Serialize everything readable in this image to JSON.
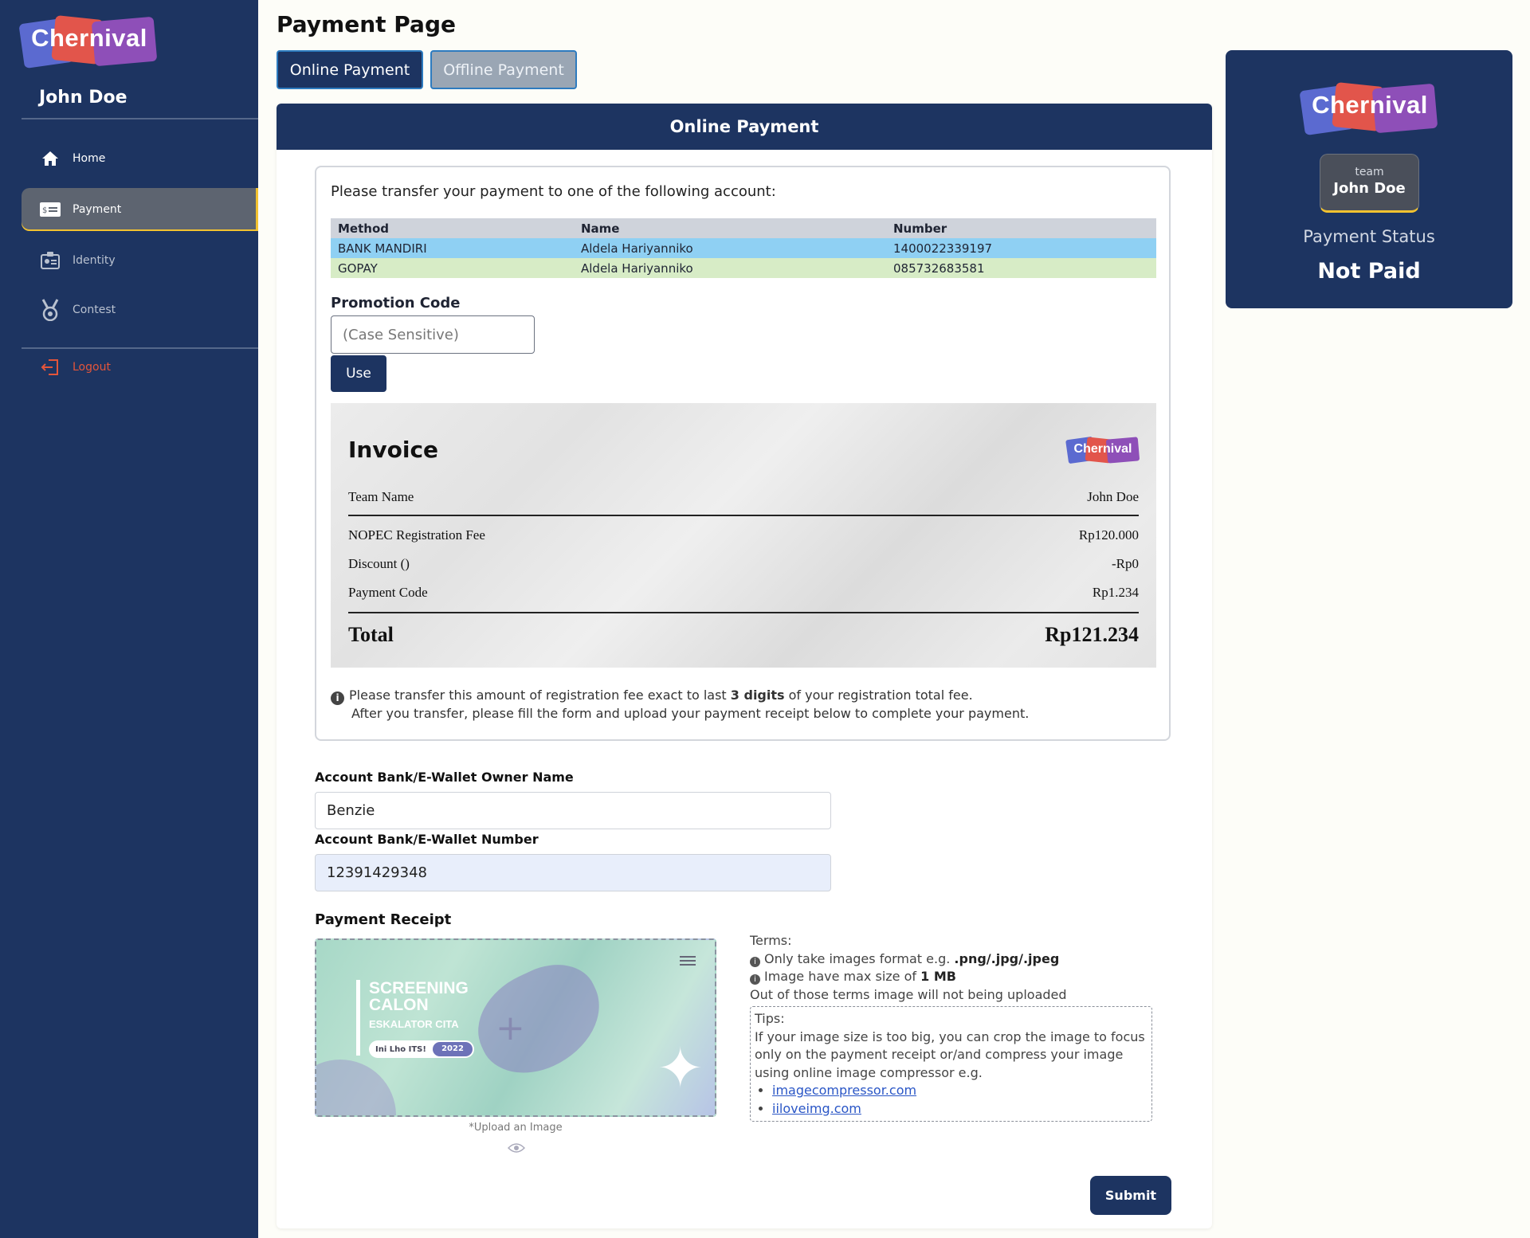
{
  "brand": {
    "name": "Chernival"
  },
  "sidebar": {
    "user_name": "John Doe",
    "items": [
      {
        "label": "Home",
        "icon": "home-icon"
      },
      {
        "label": "Payment",
        "icon": "payment-card-icon",
        "active": true
      },
      {
        "label": "Identity",
        "icon": "id-card-icon"
      },
      {
        "label": "Contest",
        "icon": "medal-icon"
      }
    ],
    "logout": "Logout"
  },
  "page": {
    "title": "Payment Page",
    "tabs": [
      {
        "label": "Online Payment",
        "active": true
      },
      {
        "label": "Offline Payment",
        "active": false
      }
    ]
  },
  "online": {
    "header": "Online Payment",
    "intro": "Please transfer your payment to one of the following account:",
    "accounts": {
      "headers": [
        "Method",
        "Name",
        "Number"
      ],
      "rows": [
        [
          "BANK MANDIRI",
          "Aldela Hariyanniko",
          "1400022339197"
        ],
        [
          "GOPAY",
          "Aldela Hariyanniko",
          "085732683581"
        ]
      ]
    },
    "promo": {
      "label": "Promotion Code",
      "placeholder": "(Case Sensitive)",
      "button": "Use"
    },
    "invoice": {
      "title": "Invoice",
      "team_label": "Team Name",
      "team_value": "John Doe",
      "fee_label": "NOPEC Registration Fee",
      "fee_value": "Rp120.000",
      "discount_label": "Discount ()",
      "discount_value": "-Rp0",
      "code_label": "Payment Code",
      "code_value": "Rp1.234",
      "total_label": "Total",
      "total_value": "Rp121.234"
    },
    "note": {
      "line1_pre": "Please transfer this amount of registration fee exact to last ",
      "line1_bold": "3 digits",
      "line1_post": " of your registration total fee.",
      "line2": "After you transfer, please fill the form and upload your payment receipt below to complete your payment."
    }
  },
  "form": {
    "owner_label": "Account Bank/E-Wallet Owner Name",
    "owner_value": "Benzie",
    "number_label": "Account Bank/E-Wallet Number",
    "number_value": "12391429348",
    "receipt_label": "Payment Receipt",
    "receipt_image": {
      "title_line1": "SCREENING",
      "title_line2": "CALON",
      "subtitle": "ESKALATOR CITA",
      "pill_text": "Ini Lho ITS!",
      "pill_year": "2022"
    },
    "upload_caption": "*Upload an Image",
    "terms": {
      "heading": "Terms:",
      "t1_pre": "Only take images format e.g. ",
      "t1_bold": ".png/.jpg/.jpeg",
      "t2_pre": "Image have max size of ",
      "t2_bold": "1 MB",
      "t3": "Out of those terms image will not being uploaded"
    },
    "tips": {
      "heading": "Tips:",
      "body": "If your image size is too big, you can crop the image to focus only on the payment receipt or/and compress your image using online image compressor e.g.",
      "links": [
        "imagecompressor.com",
        "iiloveimg.com"
      ]
    },
    "submit": "Submit"
  },
  "status_card": {
    "team_small": "team",
    "team_name": "John Doe",
    "status_label": "Payment Status",
    "status_value": "Not Paid"
  }
}
